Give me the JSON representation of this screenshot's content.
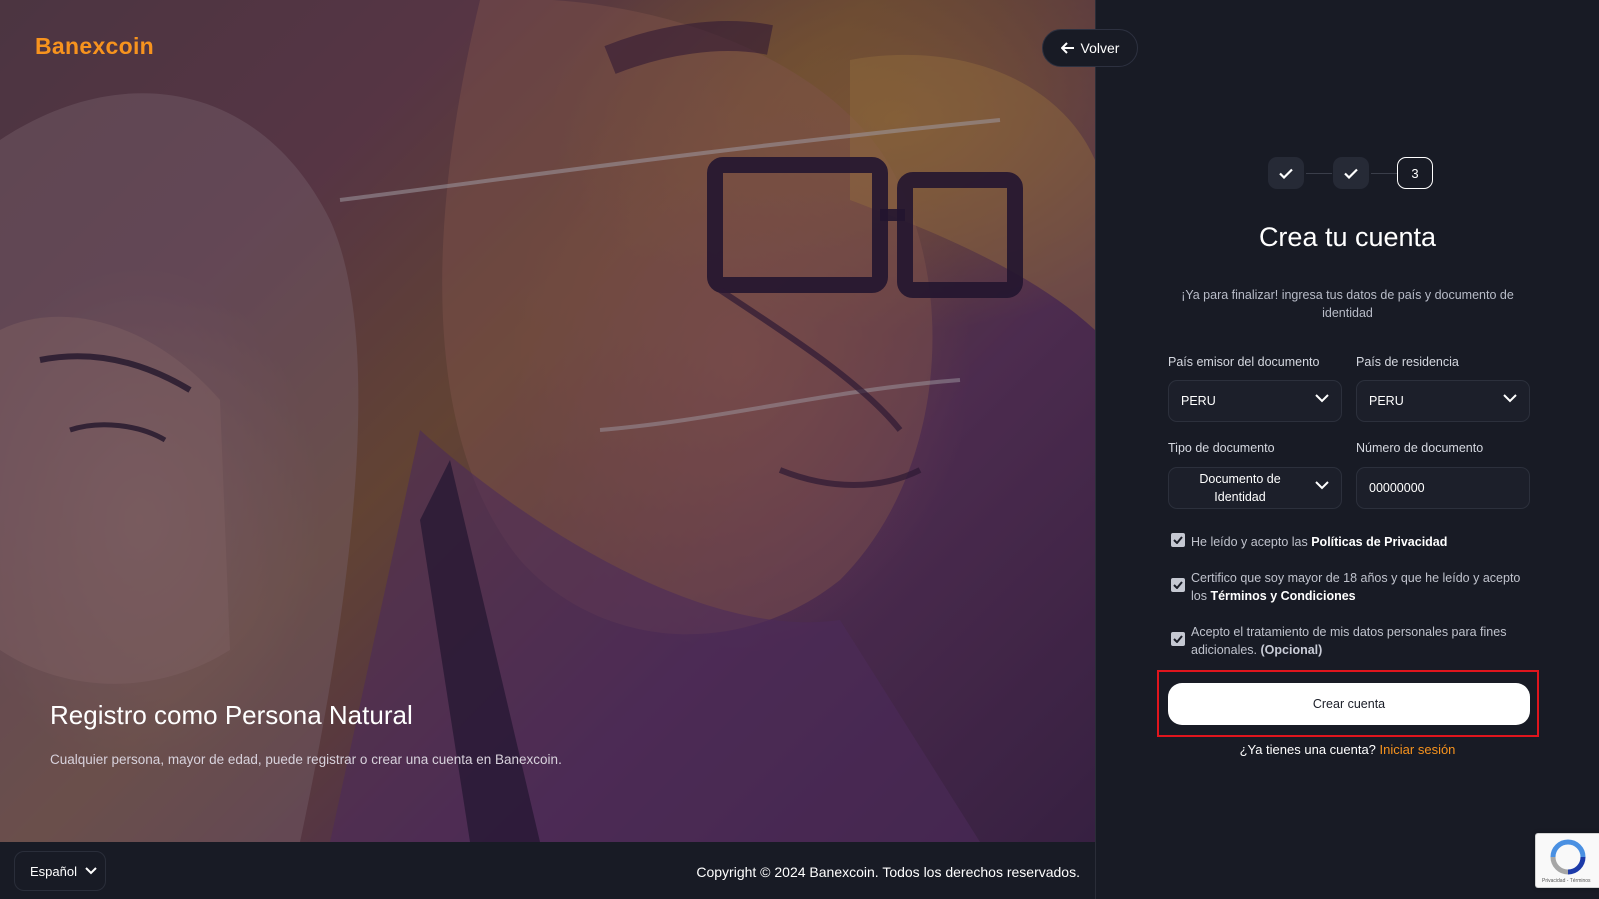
{
  "brand": {
    "name_part1": "Banex",
    "name_part2": "coin"
  },
  "header": {
    "back_label": "Volver"
  },
  "hero": {
    "title": "Registro como Persona Natural",
    "subtitle": "Cualquier persona, mayor de edad, puede registrar o crear una cuenta en Banexcoin."
  },
  "footer": {
    "language": "Español",
    "copyright": "Copyright © 2024 Banexcoin. Todos los derechos reservados."
  },
  "stepper": {
    "steps": [
      {
        "state": "done"
      },
      {
        "state": "done"
      },
      {
        "state": "active",
        "label": "3"
      }
    ]
  },
  "form": {
    "title": "Crea tu cuenta",
    "subtitle": "¡Ya para finalizar! ingresa tus datos de país y documento de identidad",
    "country_issuer": {
      "label": "País emisor del documento",
      "value": "PERU"
    },
    "country_residence": {
      "label": "País de residencia",
      "value": "PERU"
    },
    "doc_type": {
      "label": "Tipo de documento",
      "value": "Documento de Identidad"
    },
    "doc_number": {
      "label": "Número de documento",
      "value": "00000000"
    },
    "checks": [
      {
        "checked": true,
        "text": "He leído y acepto las ",
        "bold": "Políticas de Privacidad"
      },
      {
        "checked": true,
        "text": "Certifico que soy mayor de 18 años y que he leído y acepto los ",
        "bold": "Términos y Condiciones"
      },
      {
        "checked": true,
        "text": "Acepto el tratamiento de mis datos personales para fines adicionales. ",
        "bold": "(Opcional)"
      }
    ],
    "submit_label": "Crear cuenta",
    "login_prompt": "¿Ya tienes una cuenta?",
    "login_link": "Iniciar sesión"
  },
  "recaptcha": {
    "footer": "Privacidad - Términos"
  },
  "colors": {
    "accent": "#f7931e",
    "background": "#181b25",
    "highlight": "#e0151d"
  }
}
